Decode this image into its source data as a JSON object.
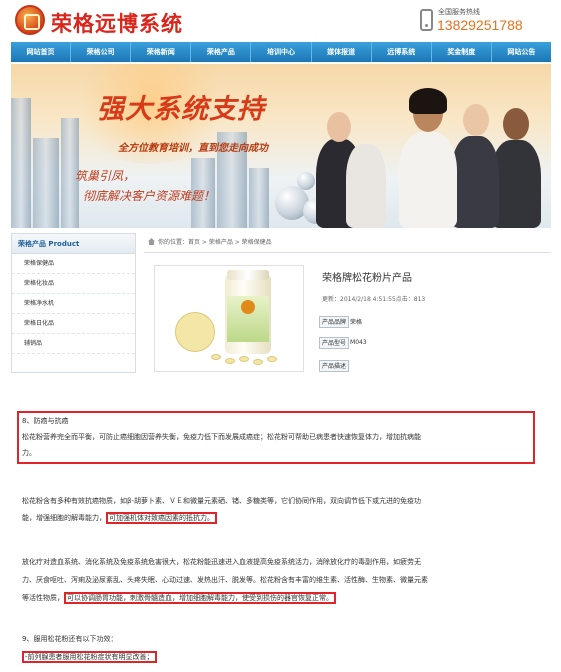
{
  "header": {
    "logo_text": "荣格远博系统",
    "hotline_label": "全国服务热线",
    "hotline_number": "13829251788"
  },
  "nav": [
    "网站首页",
    "荣格公司",
    "荣格新闻",
    "荣格产品",
    "培训中心",
    "媒体报道",
    "远博系统",
    "奖金制度",
    "网站公告"
  ],
  "banner": {
    "title": "强大系统支持",
    "subtitle": "全方位教育培训，直到您走向成功",
    "line1": "筑巢引凤，",
    "line2": "彻底解决客户资源难题！"
  },
  "sidebar": {
    "title": "荣格产品 Product",
    "items": [
      "荣格保健品",
      "荣格化妆品",
      "荣格净水机",
      "荣格日化品",
      "辅销品"
    ]
  },
  "breadcrumb": "你的位置：首页 > 荣格产品 > 荣格保健品",
  "product": {
    "title": "荣格牌松花粉片产品",
    "meta": "更新：2014/2/18 4:51:55点击：813",
    "specs": [
      {
        "label": "产品品牌",
        "value": "荣格"
      },
      {
        "label": "产品型号",
        "value": "M043"
      },
      {
        "label": "产品描述",
        "value": ""
      }
    ]
  },
  "article": {
    "p1_line1": "8、防癌与抗癌",
    "p1_line2": "松花粉营养完全而平衡，可防止癌细胞因营养失衡，免疫力低下而发展成癌症；松花粉可帮助已病患者快速恢复体力，增加抗病能",
    "p1_line3": "力。",
    "p2_line1": "松花粉含有多种有效抗癌物质，如β-胡萝卜素、ＶＥ和微量元素硒、锗、多糖类等，它们协同作用，双向调节低下或亢进的免疫功",
    "p2_line2a": "能，增强细胞的解毒能力，",
    "p2_line2b": "可加强机体对致癌因素的抵抗力。",
    "p3_line1": "放化疗对造血系统、消化系统及免疫系统危害很大，松花粉能迅速进入血液提高免疫系统活力，消除放化疗的毒副作用，如疲劳无",
    "p3_line2": "力、厌食呕吐、泻痢及泌尿紊乱、头疼失眠、心动过速、发热出汗、脱发等。松花粉含有丰富的维生素、活性酶、生物素、微量元素",
    "p3_line3a": "等活性物质，",
    "p3_line3b": "可以协调肠胃功能，刺激骨髓造血，增加细胞解毒能力，使受到损伤的器官恢复正常。",
    "p4_line1": "9、服用松花粉还有以下功效：",
    "p4_line2": "-前列腺患者服用松花粉症状有明显改善；"
  },
  "colors": {
    "logo": "#d9261c",
    "nav": "#1c76b6",
    "highlight": "#e0242a",
    "hotline": "#e2721c"
  }
}
